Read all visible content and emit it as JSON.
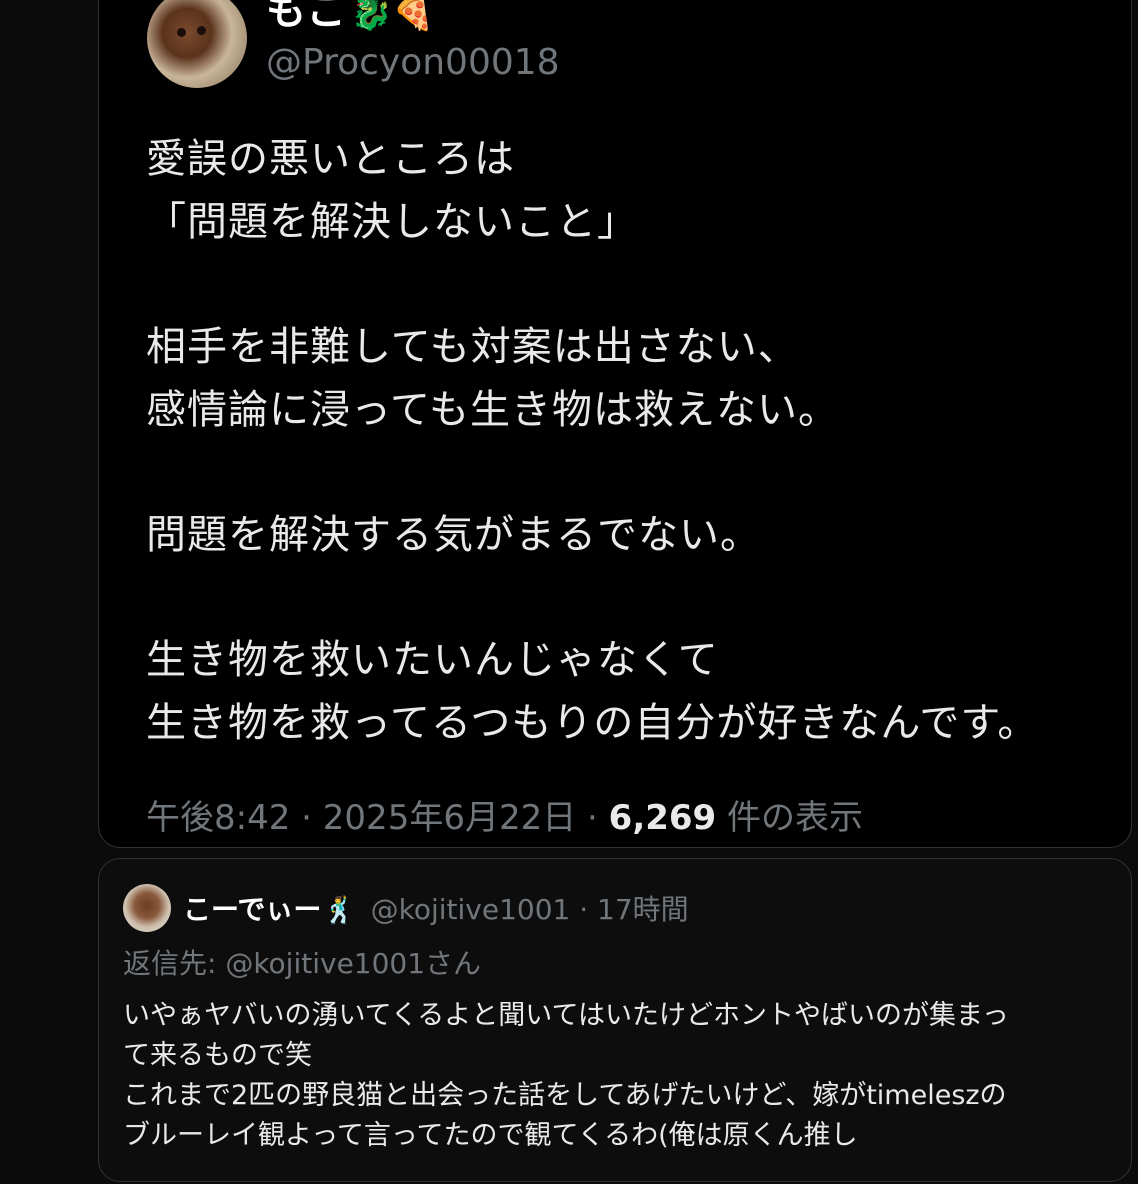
{
  "main_tweet": {
    "display_name": "もこ",
    "name_emojis": "🐉🍕",
    "handle": "@Procyon00018",
    "avatar_icon": "dog-avatar",
    "text_lines": [
      "愛誤の悪いところは",
      "「問題を解決しないこと」",
      "",
      "相手を非難しても対案は出さない、",
      "感情論に浸っても生き物は救えない。",
      "",
      "問題を解決する気がまるでない。",
      "",
      "生き物を救いたいんじゃなくて",
      "生き物を救ってるつもりの自分が好きなんです。"
    ],
    "time": "午後8:42",
    "date": "2025年6月22日",
    "separator": "·",
    "views_count": "6,269",
    "views_label": "件の表示"
  },
  "reply": {
    "display_name": "こーでぃー",
    "name_emoji": "🕺",
    "handle": "@kojitive1001",
    "separator": "·",
    "time_ago": "17時間",
    "reply_to_label": "返信先: @kojitive1001さん",
    "avatar_icon": "dog-avatar",
    "text_lines": [
      "いやぁヤバいの湧いてくるよと聞いてはいたけどホントやばいのが集まっ",
      "て来るもので笑",
      "これまで2匹の野良猫と出会った話をしてあげたいけど、嫁がtimeleszの",
      "ブルーレイ観よって言ってたので観てくるわ(俺は原くん推し"
    ]
  }
}
